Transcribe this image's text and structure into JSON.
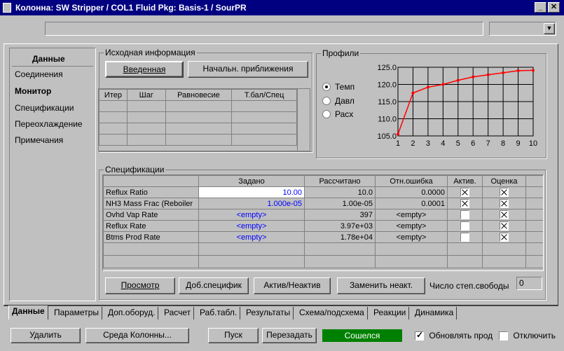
{
  "window": {
    "title": "Колонна: SW Stripper / COL1  Fluid Pkg: Basis-1 / SourPR"
  },
  "sidebar": {
    "header": "Данные",
    "items": [
      "Соединения",
      "Монитор",
      "Спецификации",
      "Переохлаждение",
      "Примечания"
    ],
    "active": "Монитор"
  },
  "input_info": {
    "label": "Исходная информация",
    "btn_entered": "Введенная",
    "btn_initial": "Начальн. приближения"
  },
  "iter_table": {
    "headers": [
      "Итер",
      "Шаг",
      "Равновесие",
      "Т.бал/Спец"
    ]
  },
  "profiles": {
    "label": "Профили",
    "options": [
      "Темп",
      "Давл",
      "Расх"
    ],
    "selected": "Темп"
  },
  "chart_data": {
    "type": "line",
    "x": [
      1,
      2,
      3,
      4,
      5,
      6,
      7,
      8,
      9,
      10
    ],
    "series": [
      {
        "values": [
          105.5,
          117.5,
          119.2,
          120.0,
          121.2,
          122.2,
          122.8,
          123.4,
          124.0,
          124.1
        ]
      }
    ],
    "ylim": [
      105,
      125
    ],
    "xlim": [
      1,
      10
    ],
    "yticks": [
      "125.0",
      "120.0",
      "115.0",
      "110.0",
      "105.0"
    ],
    "xticks": [
      "1",
      "2",
      "3",
      "4",
      "5",
      "6",
      "7",
      "8",
      "9",
      "10"
    ],
    "grid": true,
    "line_color": "#ff0000"
  },
  "specs": {
    "label": "Спецификации",
    "headers": [
      "",
      "Задано",
      "Рассчитано",
      "Отн.ошибка",
      "Актив.",
      "Оценка"
    ],
    "rows": [
      {
        "name": "Reflux Ratio",
        "set": "10.00",
        "calc": "10.0",
        "err": "0.0000",
        "active": true,
        "estimate": true
      },
      {
        "name": "NH3 Mass Frac (Reboiler",
        "set": "1.000e-05",
        "calc": "1.00e-05",
        "err": "0.0001",
        "active": true,
        "estimate": true
      },
      {
        "name": "Ovhd Vap Rate",
        "set": "<empty>",
        "calc": "397",
        "err": "<empty>",
        "active": false,
        "estimate": true
      },
      {
        "name": "Reflux Rate",
        "set": "<empty>",
        "calc": "3.97e+03",
        "err": "<empty>",
        "active": false,
        "estimate": true
      },
      {
        "name": "Btms Prod Rate",
        "set": "<empty>",
        "calc": "1.78e+04",
        "err": "<empty>",
        "active": false,
        "estimate": true
      }
    ],
    "btn_view": "Просмотр",
    "btn_add": "Доб.специфик",
    "btn_toggle": "Актив/Неактив",
    "btn_replace": "Заменить неакт.",
    "dof_label": "Число степ.свободы",
    "dof_value": "0"
  },
  "tabs": [
    "Данные",
    "Параметры",
    "Доп.оборуд.",
    "Расчет",
    "Раб.табл.",
    "Результаты",
    "Схема/подсхема",
    "Реакции",
    "Динамика"
  ],
  "bottom": {
    "btn_delete": "Удалить",
    "btn_env": "Среда Колонны...",
    "btn_run": "Пуск",
    "btn_reset": "Перезадать",
    "status": "Сошелся",
    "status_color": "#008000",
    "chk_update": "Обновлять прод",
    "chk_update_checked": true,
    "chk_disable": "Отключить",
    "chk_disable_checked": false
  }
}
